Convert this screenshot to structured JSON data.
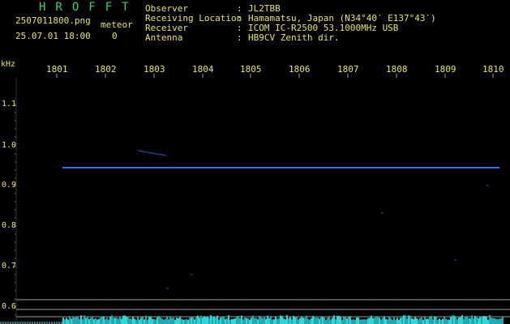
{
  "header": {
    "brand": "HROFFT",
    "filename": "2507011800.png",
    "datetime": "25.07.01 18:00",
    "meteor_label": "meteor",
    "meteor_count": "0",
    "observer_label": "Observer",
    "observer_value": "JL2TBB",
    "location_label": "Receiving Location",
    "location_value": "Hamamatsu, Japan (N34°40′ E137°43′)",
    "receiver_label": "Receiver",
    "receiver_value": "ICOM IC-R2500 53.1000MHz USB",
    "antenna_label": "Antenna",
    "antenna_value": "HB9CV Zenith dir.",
    "separator": ":"
  },
  "time_axis": {
    "ticks": [
      "1801",
      "1802",
      "1803",
      "1804",
      "1805",
      "1806",
      "1807",
      "1808",
      "1809",
      "1810"
    ]
  },
  "freq_axis": {
    "unit": "kHz",
    "ticks": [
      "1.1",
      "1.0",
      "0.9",
      "0.8",
      "0.7",
      "0.6"
    ]
  },
  "colors": {
    "background": "#000000",
    "text": "#e9e26a",
    "brand": "#3fcf6a",
    "signal_line": "#3a6cff",
    "noise": "#2fd6d6",
    "grid": "#9aa0a0"
  }
}
